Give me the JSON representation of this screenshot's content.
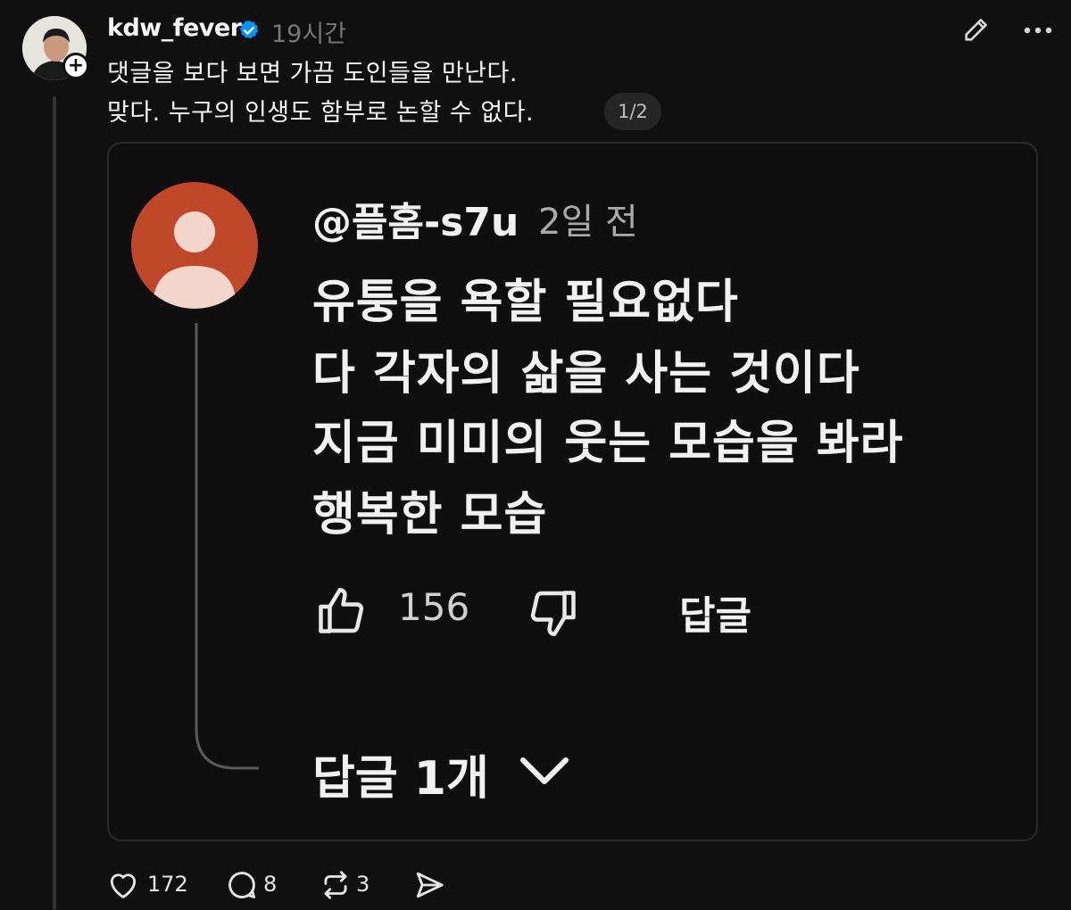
{
  "post": {
    "username": "kdw_fever",
    "timestamp": "19시간",
    "text_lines": [
      "댓글을 보다 보면 가끔 도인들을 만난다.",
      "맞다. 누구의 인생도 함부로 논할 수 없다."
    ],
    "page_indicator": "1/2"
  },
  "embedded_comment": {
    "handle": "@플홈-s7u",
    "time": "2일 전",
    "lines": [
      "유퉁을 욕할 필요없다",
      "다 각자의 삶을 사는 것이다",
      "지금 미미의 웃는 모습을 봐라",
      "행복한 모습"
    ],
    "like_count": "156",
    "reply_label": "답글",
    "replies_label": "답글 1개",
    "avatar_color": "#c0482a"
  },
  "actions": {
    "likes": "172",
    "comments": "8",
    "reposts": "3"
  },
  "icons": [
    "verified-badge-icon",
    "edit-icon",
    "more-icon",
    "heart-icon",
    "comment-icon",
    "repost-icon",
    "share-icon",
    "thumbs-up-icon",
    "thumbs-down-icon",
    "chevron-down-icon"
  ],
  "colors": {
    "background": "#101010",
    "verified": "#0095f6",
    "muted_text": "#777777"
  }
}
